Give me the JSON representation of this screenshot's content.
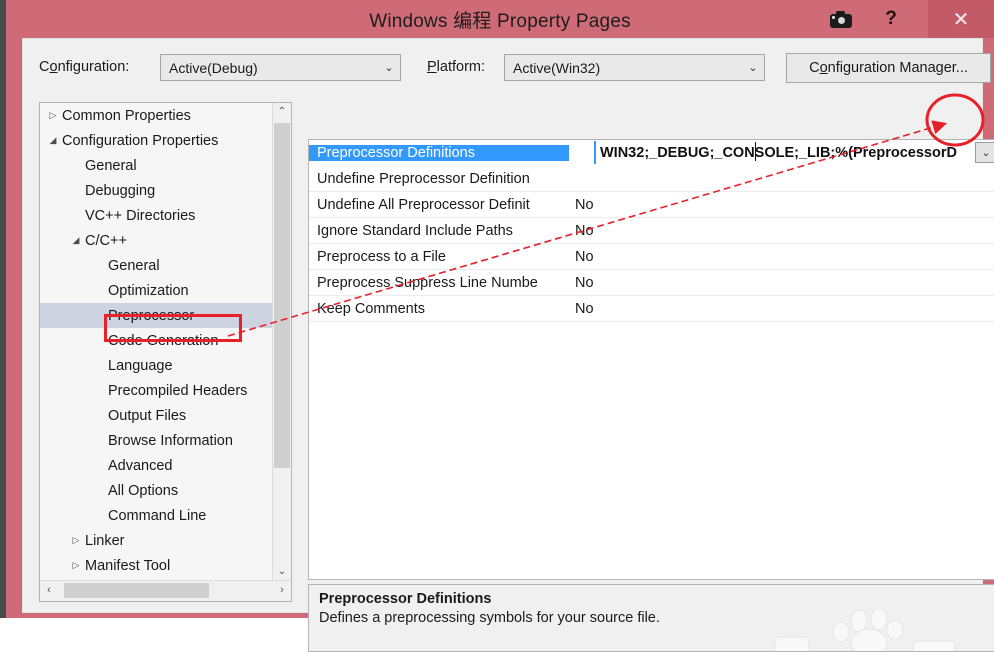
{
  "window": {
    "title": "Windows 编程 Property Pages",
    "titlebar_color": "#cf6b76",
    "close_label": "✕",
    "help_label": "?",
    "camera_icon": "camera-icon"
  },
  "toolbar": {
    "configuration_label_pre": "C",
    "configuration_label_acc": "o",
    "configuration_label_post": "nfiguration:",
    "configuration_value": "Active(Debug)",
    "platform_label_pre": "",
    "platform_label_acc": "P",
    "platform_label_post": "latform:",
    "platform_value": "Active(Win32)",
    "config_manager_pre": "C",
    "config_manager_acc": "o",
    "config_manager_post": "nfiguration Manager...",
    "dropdown_arrow": "⌄"
  },
  "tree": {
    "items": [
      {
        "label": "Common Properties",
        "indent": 0,
        "expander": "collapsed",
        "selected": false
      },
      {
        "label": "Configuration Properties",
        "indent": 0,
        "expander": "expanded",
        "selected": false
      },
      {
        "label": "General",
        "indent": 1,
        "expander": "none",
        "selected": false
      },
      {
        "label": "Debugging",
        "indent": 1,
        "expander": "none",
        "selected": false
      },
      {
        "label": "VC++ Directories",
        "indent": 1,
        "expander": "none",
        "selected": false
      },
      {
        "label": "C/C++",
        "indent": 1,
        "expander": "expanded",
        "selected": false
      },
      {
        "label": "General",
        "indent": 2,
        "expander": "none",
        "selected": false
      },
      {
        "label": "Optimization",
        "indent": 2,
        "expander": "none",
        "selected": false
      },
      {
        "label": "Preprocessor",
        "indent": 2,
        "expander": "none",
        "selected": true
      },
      {
        "label": "Code Generation",
        "indent": 2,
        "expander": "none",
        "selected": false
      },
      {
        "label": "Language",
        "indent": 2,
        "expander": "none",
        "selected": false
      },
      {
        "label": "Precompiled Headers",
        "indent": 2,
        "expander": "none",
        "selected": false
      },
      {
        "label": "Output Files",
        "indent": 2,
        "expander": "none",
        "selected": false
      },
      {
        "label": "Browse Information",
        "indent": 2,
        "expander": "none",
        "selected": false
      },
      {
        "label": "Advanced",
        "indent": 2,
        "expander": "none",
        "selected": false
      },
      {
        "label": "All Options",
        "indent": 2,
        "expander": "none",
        "selected": false
      },
      {
        "label": "Command Line",
        "indent": 2,
        "expander": "none",
        "selected": false
      },
      {
        "label": "Linker",
        "indent": 1,
        "expander": "collapsed",
        "selected": false
      },
      {
        "label": "Manifest Tool",
        "indent": 1,
        "expander": "collapsed",
        "selected": false
      }
    ],
    "scroll_up_glyph": "⌃",
    "scroll_down_glyph": "⌄",
    "scroll_left_glyph": "‹",
    "scroll_right_glyph": "›"
  },
  "grid": {
    "rows": [
      {
        "name": "Preprocessor Definitions",
        "value": "WIN32;_DEBUG;_CONSOLE;_LIB;%(PreprocessorD",
        "selected": true,
        "editing": true
      },
      {
        "name": "Undefine Preprocessor Definition",
        "value": "",
        "selected": false,
        "editing": false
      },
      {
        "name": "Undefine All Preprocessor Definit",
        "value": "No",
        "selected": false,
        "editing": false
      },
      {
        "name": "Ignore Standard Include Paths",
        "value": "No",
        "selected": false,
        "editing": false
      },
      {
        "name": "Preprocess to a File",
        "value": "No",
        "selected": false,
        "editing": false
      },
      {
        "name": "Preprocess Suppress Line Numbe",
        "value": "No",
        "selected": false,
        "editing": false
      },
      {
        "name": "Keep Comments",
        "value": "No",
        "selected": false,
        "editing": false
      }
    ],
    "editor_dropdown_glyph": "⌄",
    "selection_color": "#3399ff"
  },
  "description": {
    "title": "Preprocessor Definitions",
    "body": "Defines a preprocessing symbols for your source file."
  },
  "annotations": {
    "highlight_color": "#e8202a",
    "box_target": "Preprocessor",
    "ellipse_target": "value-editor-dropdown",
    "arrow": "points from Preprocessor tree item to the value editor dropdown arrow"
  }
}
